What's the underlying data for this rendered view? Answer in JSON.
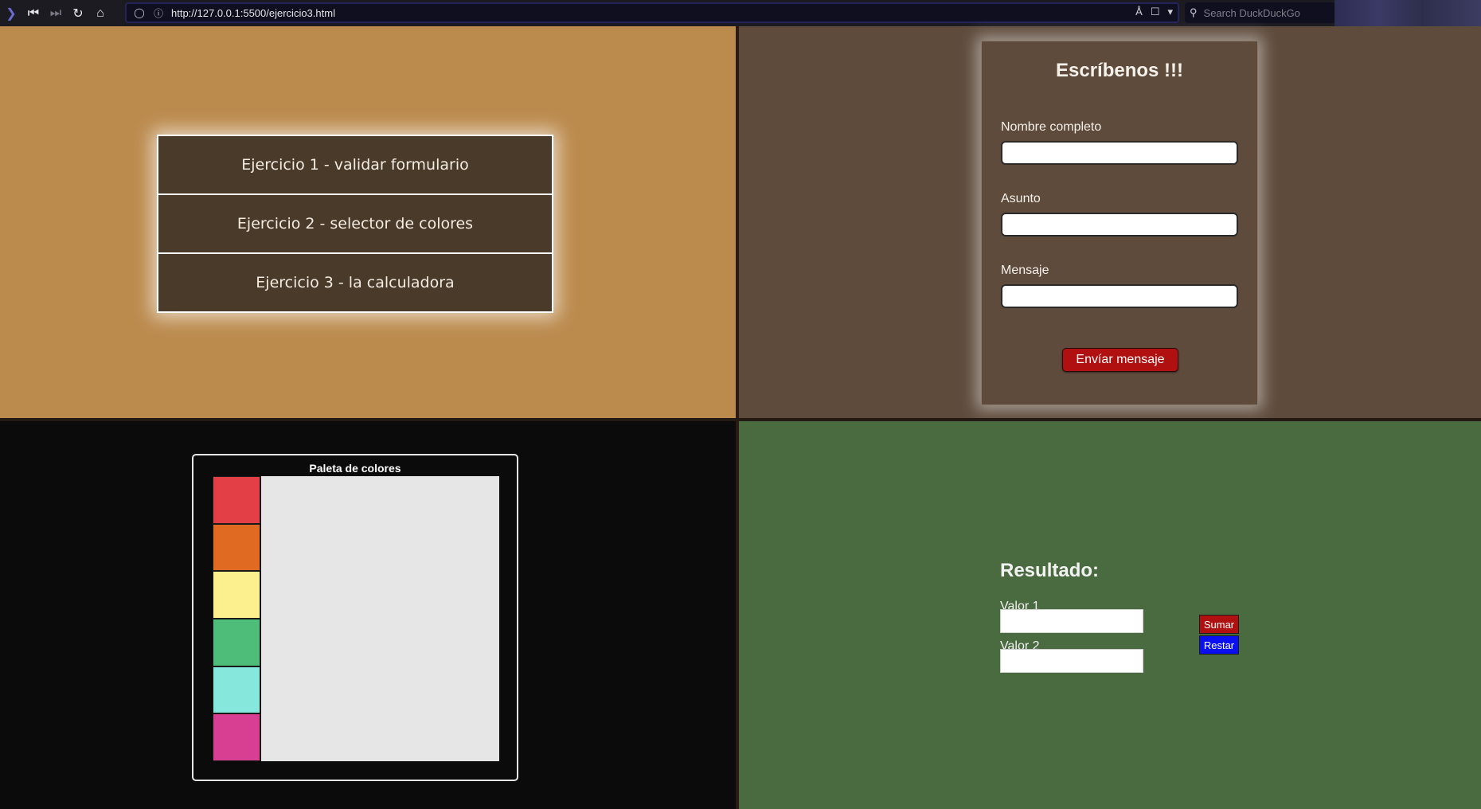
{
  "browser": {
    "url": "http://127.0.0.1:5500/ejercicio3.html",
    "search_placeholder": "Search DuckDuckGo"
  },
  "menu": {
    "items": [
      {
        "label": "Ejercicio 1 - validar formulario"
      },
      {
        "label": "Ejercicio 2 - selector de colores"
      },
      {
        "label": "Ejercicio 3 - la calculadora"
      }
    ]
  },
  "contact_form": {
    "title": "Escríbenos !!!",
    "name_label": "Nombre completo",
    "subject_label": "Asunto",
    "message_label": "Mensaje",
    "name_value": "",
    "subject_value": "",
    "message_value": "",
    "submit_label": "Envíar mensaje"
  },
  "palette": {
    "title": "Paleta de colores",
    "colors": [
      "#e24046",
      "#e06a22",
      "#fbef8e",
      "#4dbd79",
      "#86e8dc",
      "#d83f92"
    ]
  },
  "calculator": {
    "title": "Resultado:",
    "value1_label": "Valor 1",
    "value2_label": "Valor 2",
    "value1": "",
    "value2": "",
    "add_label": "Sumar",
    "subtract_label": "Restar",
    "add_color": "#b01010",
    "subtract_color": "#0a10f0"
  }
}
